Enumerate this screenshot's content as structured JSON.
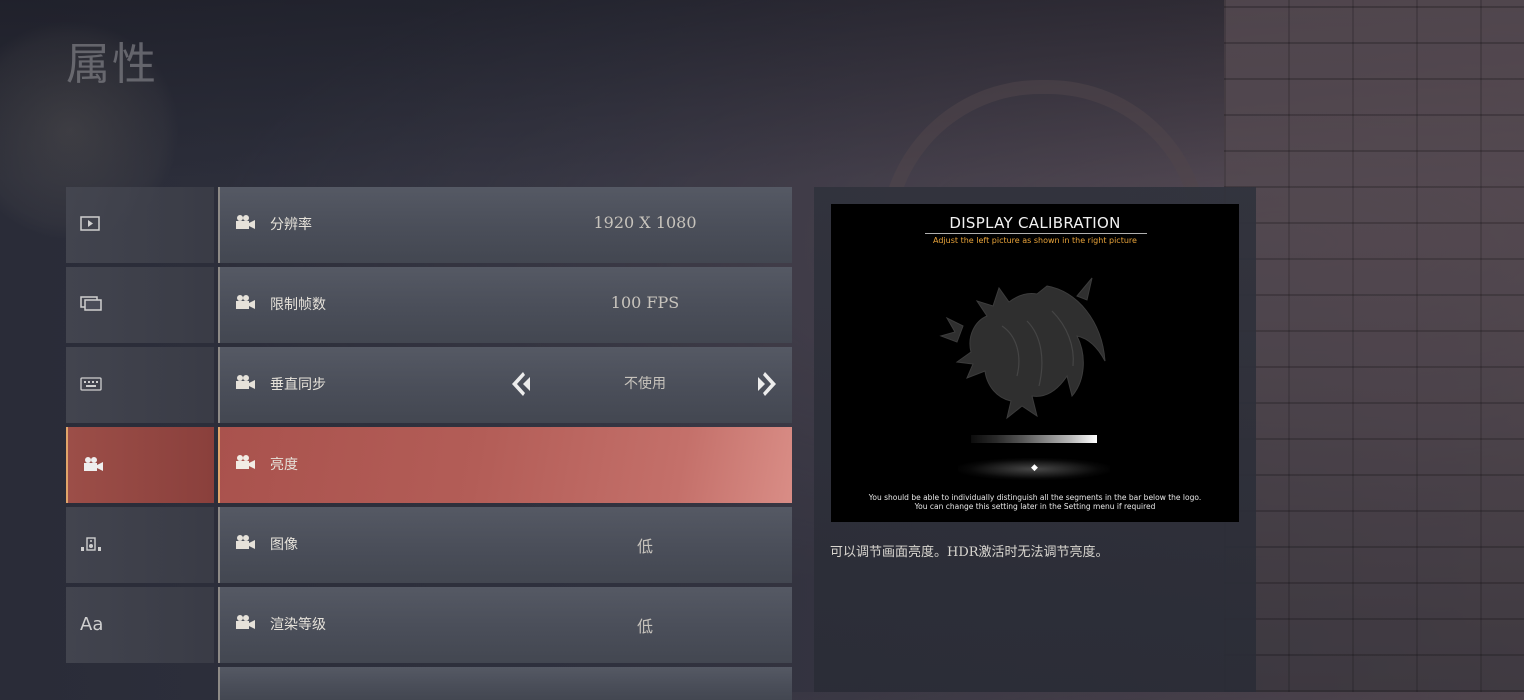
{
  "page_title": "属性",
  "categories": [
    {
      "icon": "▶",
      "name": "display"
    },
    {
      "icon": "▭",
      "name": "window"
    },
    {
      "icon": "⌨",
      "name": "keyboard"
    },
    {
      "icon": "🎥",
      "name": "camera"
    },
    {
      "icon": "⚙",
      "name": "audio"
    },
    {
      "icon": "Aa",
      "name": "font"
    }
  ],
  "settings": [
    {
      "label": "分辨率",
      "value": "1920 X 1080"
    },
    {
      "label": "限制帧数",
      "value": "100 FPS"
    },
    {
      "label": "垂直同步",
      "value": "不使用"
    },
    {
      "label": "亮度",
      "value": ""
    },
    {
      "label": "图像",
      "value": "低"
    },
    {
      "label": "渲染等级",
      "value": "低"
    }
  ],
  "detail": {
    "calibration_title": "DISPLAY CALIBRATION",
    "calibration_subtitle": "Adjust the left picture as shown in the right picture",
    "calibration_note_1": "You should be able to individually distinguish all the segments in the bar below the logo.",
    "calibration_note_2": "You can change this setting later in the Setting menu if required",
    "description": "可以调节画面亮度。HDR激活时无法调节亮度。"
  },
  "colors": {
    "accent": "#e1a56a",
    "active_row": "#b35d57",
    "calib_subtitle": "#e8a33a"
  }
}
